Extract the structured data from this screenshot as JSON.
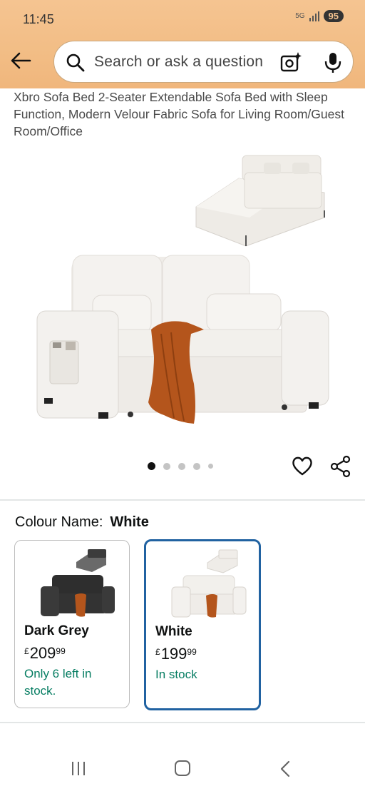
{
  "status_bar": {
    "time": "11:45",
    "network": "5G",
    "battery": "95"
  },
  "search": {
    "placeholder": "Search or ask a question",
    "icons": [
      "search-icon",
      "camera-lens-icon",
      "microphone-icon"
    ]
  },
  "product": {
    "title": "Xbro Sofa Bed 2-Seater Extendable Sofa Bed with Sleep Function, Modern Velour Fabric Sofa for Living Room/Guest Room/Office",
    "image_count": 5,
    "active_image_index": 1
  },
  "colour": {
    "label": "Colour Name:",
    "selected": "White",
    "options": [
      {
        "name": "Dark Grey",
        "currency": "£",
        "whole": "209",
        "fraction": "99",
        "stock": "Only 6 left in stock.",
        "selected": false
      },
      {
        "name": "White",
        "currency": "£",
        "whole": "199",
        "fraction": "99",
        "stock": "In stock",
        "selected": true
      }
    ]
  },
  "colors": {
    "header": "#f2bd85",
    "stock_green": "#067d62",
    "selected_border": "#2162a1"
  },
  "nav_bar": {
    "icons": [
      "recent-apps-icon",
      "home-icon",
      "back-icon"
    ]
  }
}
